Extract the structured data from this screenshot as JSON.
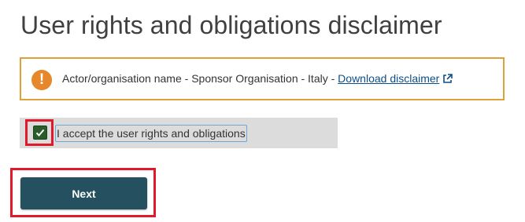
{
  "page": {
    "title": "User rights and obligations disclaimer"
  },
  "notice": {
    "icon": "warning-icon",
    "text": "Actor/organisation name - Sponsor Organisation - Italy - ",
    "link_label": "Download disclaimer",
    "link_icon": "external-link-icon",
    "border_color": "#e0a038",
    "icon_color": "#e5872a"
  },
  "accept": {
    "checked": true,
    "label": "I accept the user rights and obligations"
  },
  "actions": {
    "next_label": "Next",
    "button_color": "#24505f"
  },
  "highlight_color": "#e01a2b"
}
